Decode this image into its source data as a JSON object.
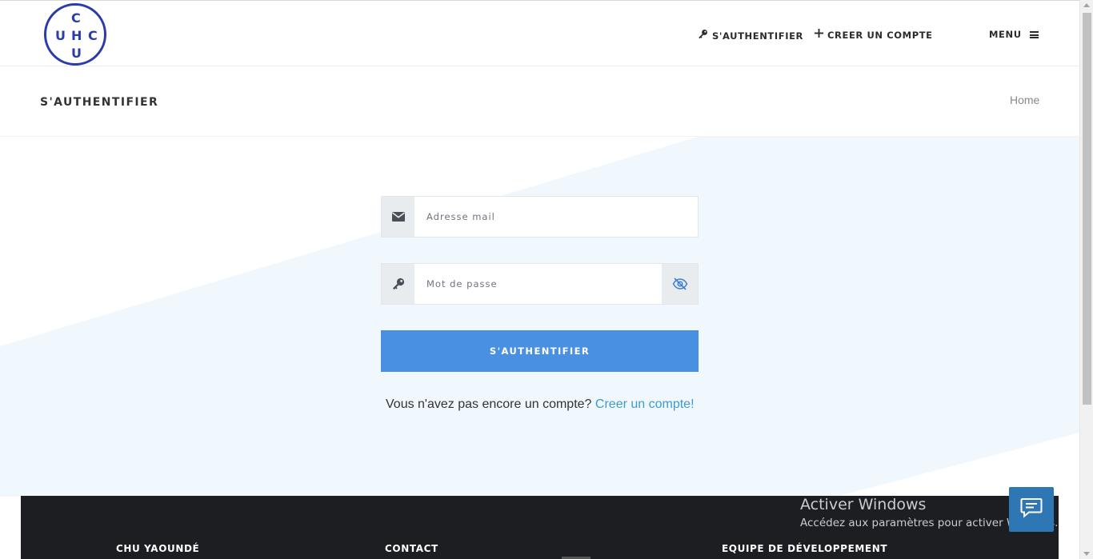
{
  "brand": {
    "logo_letters": {
      "top": "C",
      "left": "U",
      "middle": "H",
      "right": "C",
      "bottom": "U"
    },
    "logo_color": "#2a3ca8"
  },
  "nav": {
    "login_label": "S'AUTHENTIFIER",
    "login_icon": "key-icon",
    "create_label": "CREER UN COMPTE",
    "create_icon": "plus-icon",
    "menu_label": "MENU",
    "menu_icon": "hamburger-icon"
  },
  "page": {
    "title": "S'AUTHENTIFIER",
    "breadcrumb": "Home"
  },
  "form": {
    "email_placeholder": "Adresse mail",
    "email_icon": "envelope-icon",
    "password_placeholder": "Mot de passe",
    "password_icon": "key-icon",
    "toggle_icon": "eye-slash-icon",
    "submit_label": "S'AUTHENTIFIER",
    "submit_color": "#4a90e2",
    "signup_prompt": "Vous n'avez pas encore un compte?",
    "signup_link": "Creer un compte!",
    "link_color": "#3d9ad6"
  },
  "footer": {
    "col1_title": "CHU YAOUNDÉ",
    "col2_title": "CONTACT",
    "col3_title": "EQUIPE DE DÉVELOPPEMENT"
  },
  "watermark": {
    "title": "Activer Windows",
    "subtitle": "Accédez aux paramètres pour activer Windows."
  },
  "chat": {
    "icon": "chat-bubble-icon",
    "color": "#2f76b5"
  }
}
